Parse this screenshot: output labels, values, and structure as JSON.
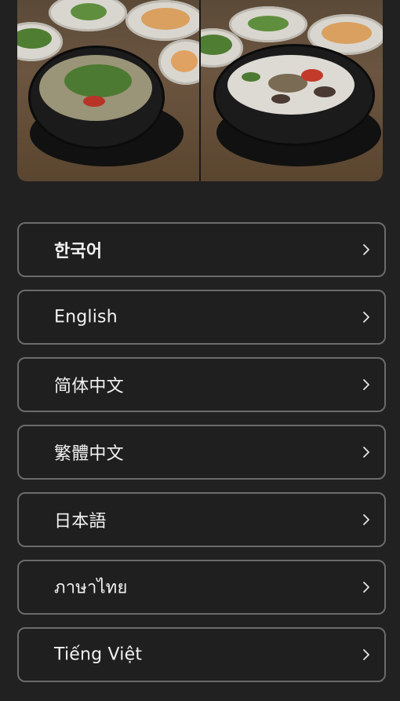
{
  "hero": {
    "image_description_icon": "food-photo-icon"
  },
  "languages": [
    {
      "label": "한국어",
      "selected": true
    },
    {
      "label": "English",
      "selected": false
    },
    {
      "label": "简体中文",
      "selected": false
    },
    {
      "label": "繁體中文",
      "selected": false
    },
    {
      "label": "日本語",
      "selected": false
    },
    {
      "label": "ภาษาไทย",
      "selected": false
    },
    {
      "label": "Tiếng Việt",
      "selected": false
    }
  ],
  "colors": {
    "background": "#212121",
    "button_border": "#6b6b6b",
    "text": "#f2f2f2"
  }
}
